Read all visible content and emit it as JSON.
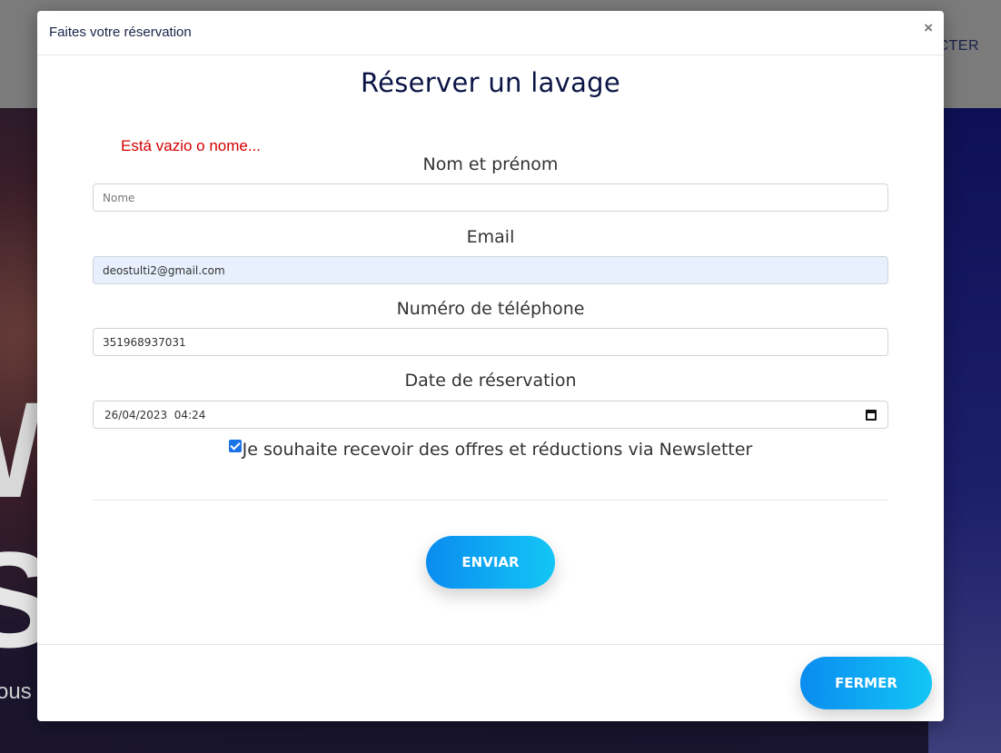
{
  "background": {
    "header_link": "CTER",
    "hero_letter_1": "W",
    "hero_letter_2": "S",
    "hero_text": "ous"
  },
  "modal": {
    "title": "Faites votre réservation",
    "close_glyph": "×",
    "heading": "Réserver un lavage",
    "error": "Está vazio o nome...",
    "fields": {
      "name": {
        "label": "Nom et prénom",
        "placeholder": "Nome",
        "value": ""
      },
      "email": {
        "label": "Email",
        "value": "deostulti2@gmail.com"
      },
      "phone": {
        "label": "Numéro de téléphone",
        "value": "351968937031"
      },
      "date": {
        "label": "Date de réservation",
        "value": "26/04/2023  04:24"
      }
    },
    "newsletter": {
      "checked": true,
      "label": "Je souhaite recevoir des offres et réductions via Newsletter"
    },
    "submit_label": "ENVIAR",
    "footer_close_label": "FERMER"
  },
  "colors": {
    "accent_start": "#0a8cf0",
    "accent_end": "#13c6f5",
    "error": "#d40000",
    "heading": "#0b1545"
  }
}
